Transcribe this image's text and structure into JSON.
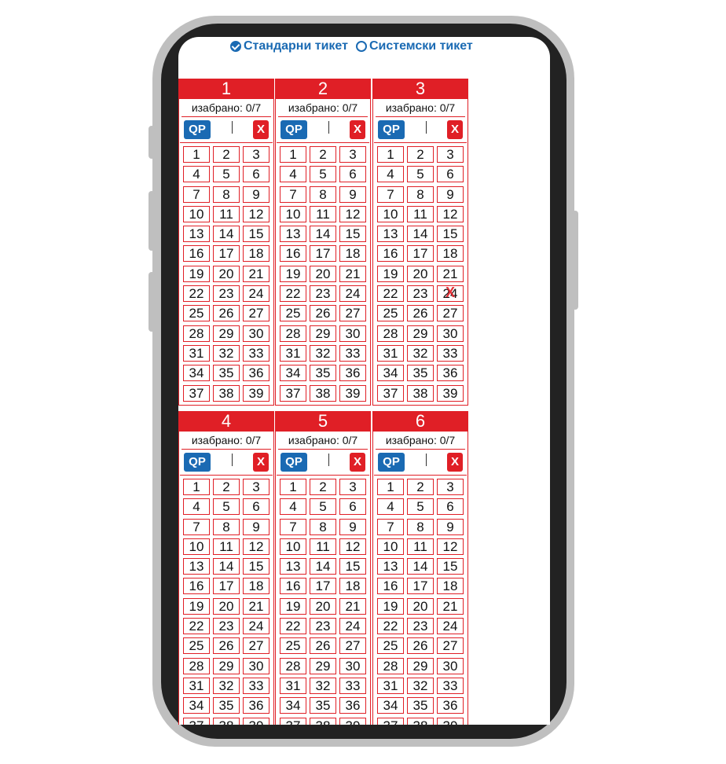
{
  "ticket_type": {
    "options": [
      {
        "label": "Стандарни тикет",
        "checked": true
      },
      {
        "label": "Системски тикет",
        "checked": false
      }
    ]
  },
  "panels": [
    {
      "title": "1",
      "count": "изабрано: 0/7",
      "qp": "QP",
      "clear": "X",
      "marked": []
    },
    {
      "title": "2",
      "count": "изабрано: 0/7",
      "qp": "QP",
      "clear": "X",
      "marked": []
    },
    {
      "title": "3",
      "count": "изабрано: 0/7",
      "qp": "QP",
      "clear": "X",
      "marked": [
        24
      ]
    },
    {
      "title": "4",
      "count": "изабрано: 0/7",
      "qp": "QP",
      "clear": "X",
      "marked": []
    },
    {
      "title": "5",
      "count": "изабрано: 0/7",
      "qp": "QP",
      "clear": "X",
      "marked": []
    },
    {
      "title": "6",
      "count": "изабрано: 0/7",
      "qp": "QP",
      "clear": "X",
      "marked": []
    }
  ],
  "numbers": [
    "1",
    "2",
    "3",
    "4",
    "5",
    "6",
    "7",
    "8",
    "9",
    "10",
    "11",
    "12",
    "13",
    "14",
    "15",
    "16",
    "17",
    "18",
    "19",
    "20",
    "21",
    "22",
    "23",
    "24",
    "25",
    "26",
    "27",
    "28",
    "29",
    "30",
    "31",
    "32",
    "33",
    "34",
    "35",
    "36",
    "37",
    "38",
    "39"
  ],
  "colors": {
    "accent_red": "#e01f26",
    "accent_blue": "#1a6ab3",
    "frame": "#bfbfbf",
    "bezel": "#222222"
  }
}
